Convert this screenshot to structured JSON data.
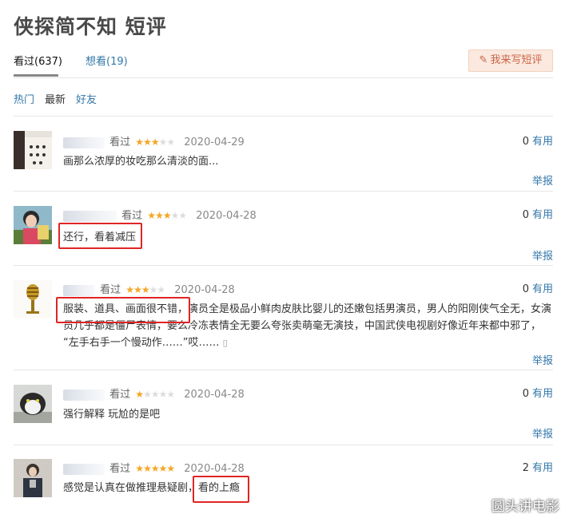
{
  "page": {
    "title": "侠探简不知 短评",
    "tabs": {
      "seen": "看过(637)",
      "want": "想看(19)"
    },
    "write_button": "我来写短评",
    "filters": [
      "热门",
      "最新",
      "好友"
    ]
  },
  "reviews": [
    {
      "status": "看过",
      "rating": 3,
      "date": "2020-04-29",
      "useful_count": "0",
      "useful_label": "有用",
      "content": "画那么浓厚的妆吃那么清淡的面...",
      "report": "举报"
    },
    {
      "status": "看过",
      "rating": 3,
      "date": "2020-04-28",
      "useful_count": "0",
      "useful_label": "有用",
      "content": "还行，看着减压",
      "report": "举报"
    },
    {
      "status": "看过",
      "rating": 3,
      "date": "2020-04-28",
      "useful_count": "0",
      "useful_label": "有用",
      "content_lines": [
        "服装、道具、画面很不错，演员全是极品小鲜肉皮肤比婴儿的还嫩包括男演员，男人的阳刚侠气全无，女演",
        "员几乎都是僵尸表情，要么冷冻表情全无要么夸张卖萌毫无演技，中国武侠电视剧好像近年来都中邪了，",
        "“左手右手一个慢动作……”哎……"
      ],
      "report": "举报"
    },
    {
      "status": "看过",
      "rating": 1,
      "date": "2020-04-28",
      "useful_count": "0",
      "useful_label": "有用",
      "content": "强行解释 玩尬的是吧",
      "report": "举报"
    },
    {
      "status": "看过",
      "rating": 5,
      "date": "2020-04-28",
      "useful_count": "2",
      "useful_label": "有用",
      "content": "感觉是认真在做推理悬疑剧，看的上瘾",
      "report": "举报"
    }
  ],
  "watermark": "圆头讲电影",
  "colors": {
    "link": "#3377aa",
    "star": "#f5a623",
    "highlight": "#e02424",
    "button_bg": "#fbe9df"
  }
}
